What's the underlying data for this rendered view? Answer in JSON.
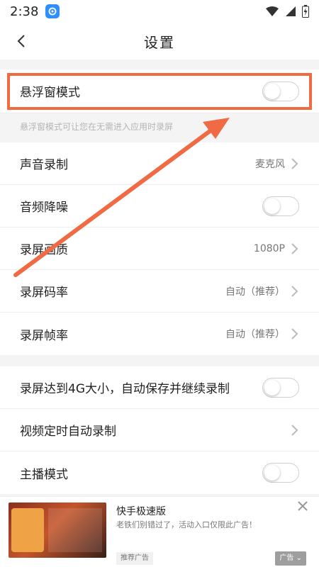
{
  "status_bar": {
    "time": "2:38"
  },
  "nav": {
    "title": "设置"
  },
  "floating_mode": {
    "label": "悬浮窗模式",
    "hint": "悬浮窗模式可让您在无需进入应用时录屏",
    "enabled": false
  },
  "settings_group_1": [
    {
      "label": "声音录制",
      "value": "麦克风"
    },
    {
      "label": "音频降噪",
      "toggle": false
    },
    {
      "label": "录屏画质",
      "value": "1080P"
    },
    {
      "label": "录屏码率",
      "value": "自动（推荐）"
    },
    {
      "label": "录屏帧率",
      "value": "自动（推荐）"
    }
  ],
  "settings_group_2": [
    {
      "label": "录屏达到4G大小，自动保存并继续录制",
      "toggle": false
    },
    {
      "label": "视频定时自动录制"
    },
    {
      "label": "主播模式",
      "toggle": false
    }
  ],
  "ad": {
    "title": "快手极速版",
    "description": "老铁们别错过了，活动入口仅限此广告！",
    "badge": "推荐广告",
    "brand_label": "广告"
  },
  "colors": {
    "highlight": "#f06a43",
    "accent": "#2f8fff"
  }
}
